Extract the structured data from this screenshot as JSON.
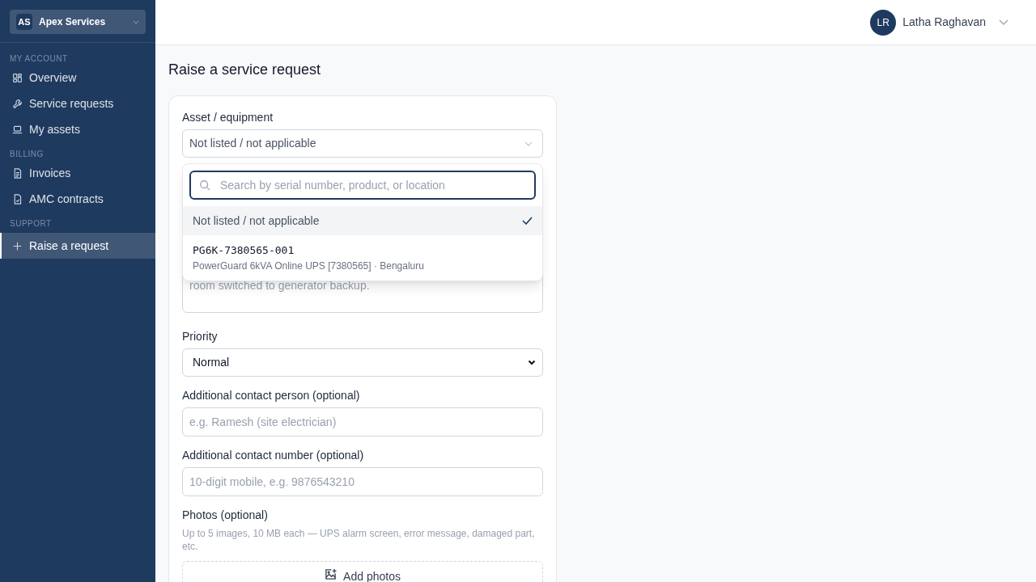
{
  "org_switcher": {
    "initials": "AS",
    "name": "Apex Services"
  },
  "sidebar": {
    "sections": [
      {
        "title": "MY ACCOUNT",
        "items": [
          {
            "label": "Overview",
            "selected": false
          },
          {
            "label": "Service requests",
            "selected": false
          },
          {
            "label": "My assets",
            "selected": false
          }
        ]
      },
      {
        "title": "BILLING",
        "items": [
          {
            "label": "Invoices",
            "selected": false
          },
          {
            "label": "AMC contracts",
            "selected": false
          }
        ]
      },
      {
        "title": "SUPPORT",
        "items": [
          {
            "label": "Raise a request",
            "selected": true
          }
        ]
      }
    ]
  },
  "user": {
    "initials": "LR",
    "name": "Latha Raghavan"
  },
  "page_title": "Raise a service request",
  "form": {
    "asset": {
      "label": "Asset / equipment",
      "value": "Not listed / not applicable",
      "open": true,
      "search_placeholder": "Search by serial number, product, or location",
      "options": [
        {
          "title": "Not listed / not applicable",
          "selected": true
        },
        {
          "title": "PG6K-7380565-001",
          "subtitle": "PowerGuard 6kVA Online UPS [7380565] · Bengaluru",
          "selected": false
        }
      ]
    },
    "description_tail": "room switched to generator backup.",
    "priority": {
      "label": "Priority",
      "value": "Normal"
    },
    "contact_person": {
      "label": "Additional contact person (optional)",
      "placeholder": "e.g. Ramesh (site electrician)"
    },
    "contact_number": {
      "label": "Additional contact number (optional)",
      "placeholder": "10-digit mobile, e.g. 9876543210"
    },
    "photos": {
      "label": "Photos (optional)",
      "hint": "Up to 5 images, 10 MB each — UPS alarm screen, error message, damaged part, etc.",
      "button": "Add photos"
    }
  }
}
